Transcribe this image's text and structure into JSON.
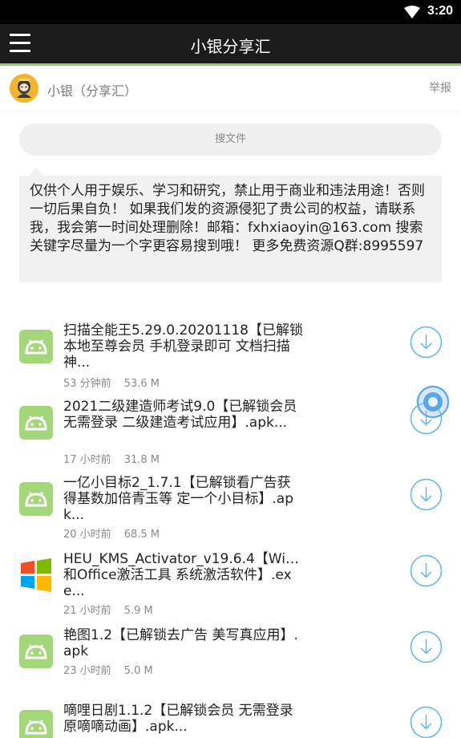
{
  "status_bar": {
    "time": "3:20",
    "wifi_icon": "wifi-icon"
  },
  "app_bar": {
    "title": "小银分享汇",
    "menu_icon": "hamburger-menu-icon"
  },
  "owner": {
    "name": "小银（分享汇）",
    "report_label": "举报",
    "avatar_icon": "avatar-icon"
  },
  "search": {
    "placeholder": "搜文件"
  },
  "notice": {
    "text": "仅供个人用于娱乐、学习和研究，禁止用于商业和违法用途！否则一切后果自负！ 如果我们发的资源侵犯了贵公司的权益，请联系我，我会第一时间处理删除！邮箱：fxhxiaoyin@163.com 搜索关键字尽量为一个字更容易搜到哦！ 更多免费资源Q群:8995597"
  },
  "files": [
    {
      "name": "扫描全能王5.29.0.20201118【已解锁本地至尊会员 手机登录即可 文档扫描神...",
      "time": "53 分钟前",
      "size": "53.6 M",
      "icon": "android-icon"
    },
    {
      "name": "2021二级建造师考试9.0【已解锁会员 无需登录 二级建造考试应用】.apk...",
      "time": "17 小时前",
      "size": "31.8 M",
      "icon": "android-icon"
    },
    {
      "name": "一亿小目标2_1.7.1【已解锁看广告获得基数加倍青玉等 定一个小目标】.apk...",
      "time": "20 小时前",
      "size": "68.5 M",
      "icon": "android-icon"
    },
    {
      "name": "HEU_KMS_Activator_v19.6.4【Wi…和Office激活工具 系统激活软件】.exe...",
      "time": "21 小时前",
      "size": "5.9 M",
      "icon": "windows-icon"
    },
    {
      "name": "艳图1.2【已解锁去广告 美写真应用】.apk",
      "time": "23 小时前",
      "size": "5.0 M",
      "icon": "android-icon"
    },
    {
      "name": "嘀哩日剧1.1.2【已解锁会员 无需登录 原嘀嘀动画】.apk...",
      "time": "",
      "size": "",
      "icon": "android-icon"
    }
  ],
  "colors": {
    "accent_green": "#8bd36a",
    "android_green": "#a4d67a",
    "download_blue": "#5bb7ee"
  }
}
